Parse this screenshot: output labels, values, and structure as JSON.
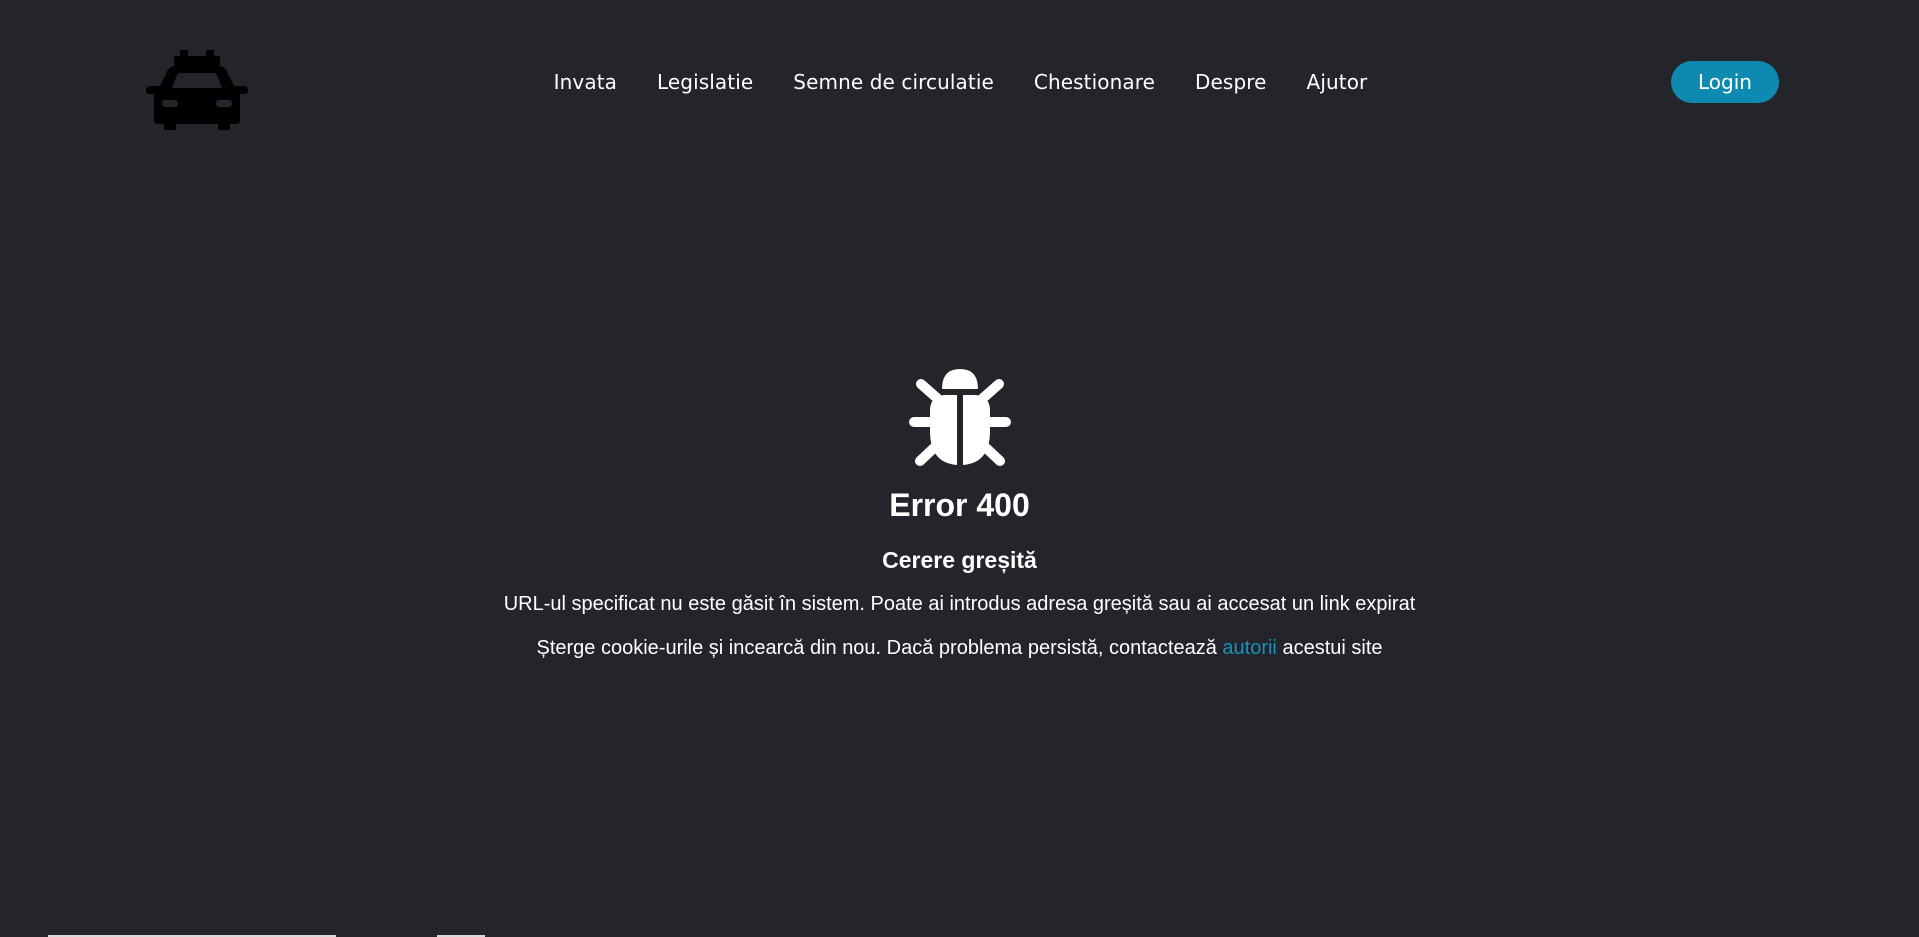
{
  "header": {
    "logo_icon": "taxi-car-icon",
    "nav": [
      {
        "label": "Invata"
      },
      {
        "label": "Legislatie"
      },
      {
        "label": "Semne de circulatie"
      },
      {
        "label": "Chestionare"
      },
      {
        "label": "Despre"
      },
      {
        "label": "Ajutor"
      }
    ],
    "login_label": "Login"
  },
  "error": {
    "icon": "bug-icon",
    "title": "Error 400",
    "subtitle": "Cerere greșită",
    "message": "URL-ul specificat nu este găsit în sistem. Poate ai introdus adresa greșită sau ai accesat un link expirat",
    "hint_before": "Șterge cookie-urile și incearcă din nou. Dacă problema persistă, contactează ",
    "hint_link": "autorii",
    "hint_after": " acestui site"
  },
  "colors": {
    "background": "#23252b",
    "accent": "#0e8ab0",
    "link": "#1a8fb8",
    "text": "#ffffff"
  }
}
